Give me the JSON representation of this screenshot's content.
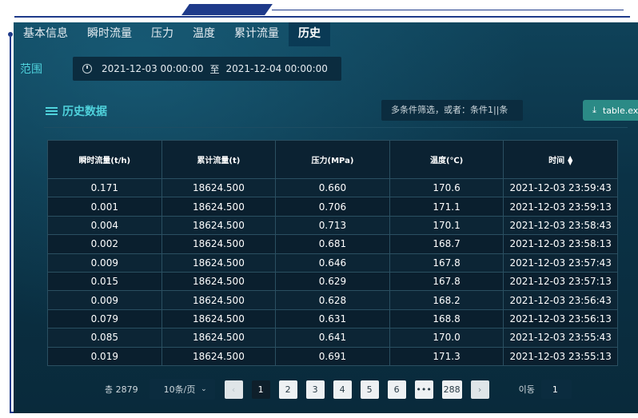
{
  "tabs": [
    "基本信息",
    "瞬时流量",
    "压力",
    "温度",
    "累计流量",
    "历史"
  ],
  "active_tab": 5,
  "range": {
    "label": "范围",
    "start": "2021-12-03 00:00:00",
    "separator": "至",
    "end": "2021-12-04 00:00:00"
  },
  "section": {
    "title": "历史数据",
    "filter_placeholder": "多条件筛选，或者：条件1||条",
    "export_label": "table.ex"
  },
  "table": {
    "headers": [
      "瞬时流量(t/h)",
      "累计流量(t)",
      "压力(MPa)",
      "温度(℃)",
      "时间"
    ],
    "rows": [
      [
        "0.171",
        "18624.500",
        "0.660",
        "170.6",
        "2021-12-03 23:59:43"
      ],
      [
        "0.001",
        "18624.500",
        "0.706",
        "171.1",
        "2021-12-03 23:59:13"
      ],
      [
        "0.004",
        "18624.500",
        "0.713",
        "170.1",
        "2021-12-03 23:58:43"
      ],
      [
        "0.002",
        "18624.500",
        "0.681",
        "168.7",
        "2021-12-03 23:58:13"
      ],
      [
        "0.009",
        "18624.500",
        "0.646",
        "167.8",
        "2021-12-03 23:57:43"
      ],
      [
        "0.015",
        "18624.500",
        "0.629",
        "167.8",
        "2021-12-03 23:57:13"
      ],
      [
        "0.009",
        "18624.500",
        "0.628",
        "168.2",
        "2021-12-03 23:56:43"
      ],
      [
        "0.079",
        "18624.500",
        "0.631",
        "168.8",
        "2021-12-03 23:56:13"
      ],
      [
        "0.085",
        "18624.500",
        "0.641",
        "170.0",
        "2021-12-03 23:55:43"
      ],
      [
        "0.019",
        "18624.500",
        "0.691",
        "171.3",
        "2021-12-03 23:55:13"
      ]
    ]
  },
  "pagination": {
    "total": "총 2879",
    "page_size": "10条/页",
    "prev": "‹",
    "next": "›",
    "pages": [
      "1",
      "2",
      "3",
      "4",
      "5",
      "6",
      "•••",
      "288"
    ],
    "current": "1",
    "goto_label": "이동",
    "goto_value": "1"
  }
}
